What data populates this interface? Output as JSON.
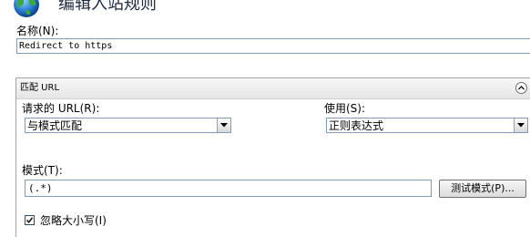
{
  "dialog": {
    "title": "编辑入站规则",
    "name_label": "名称(N):",
    "name_value": "Redirect to https"
  },
  "match_url": {
    "section_title": "匹配 URL",
    "requested_url_label": "请求的 URL(R):",
    "requested_url_value": "与模式匹配",
    "using_label": "使用(S):",
    "using_value": "正则表达式",
    "pattern_label": "模式(T):",
    "pattern_value": "(.*)",
    "test_pattern_button": "测试模式(P)...",
    "ignore_case_label": "忽略大小写(I)",
    "ignore_case_checked": true
  },
  "icons": {
    "title_icon": "globe-icon",
    "collapse": "chevron-up-icon",
    "dropdown": "chevron-down-icon",
    "check": "check-icon"
  }
}
